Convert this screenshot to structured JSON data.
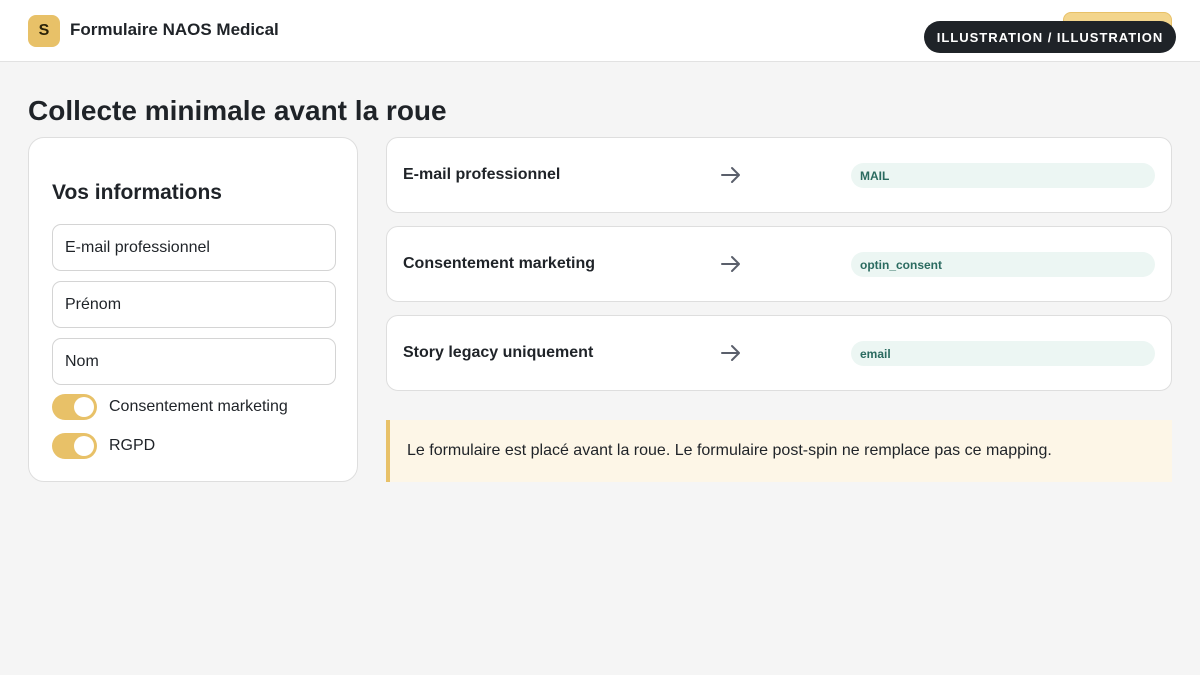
{
  "header": {
    "logo_letter": "S",
    "title": "Formulaire NAOS Medical",
    "badge": "ILLUSTRATION / ILLUSTRATION"
  },
  "page_title": "Collecte minimale avant la roue",
  "form": {
    "heading": "Vos informations",
    "fields": [
      {
        "placeholder": "E-mail professionnel"
      },
      {
        "placeholder": "Prénom"
      },
      {
        "placeholder": "Nom"
      }
    ],
    "toggles": [
      {
        "label": "Consentement marketing",
        "on": true
      },
      {
        "label": "RGPD",
        "on": true
      }
    ]
  },
  "mappings": [
    {
      "source": "E-mail professionnel",
      "target": "MAIL",
      "arrow_icon": "arrow-right-icon"
    },
    {
      "source": "Consentement marketing",
      "target": "optin_consent",
      "arrow_icon": "arrow-right-icon"
    },
    {
      "source": "Story legacy uniquement",
      "target": "email",
      "arrow_icon": "arrow-right-icon"
    }
  ],
  "notice": "Le formulaire est placé avant la roue. Le formulaire post-spin ne remplace pas ce mapping.",
  "colors": {
    "accent": "#e8c168",
    "pill_bg": "#ecf6f3",
    "pill_text": "#2b6b60",
    "dark": "#1f2328"
  }
}
